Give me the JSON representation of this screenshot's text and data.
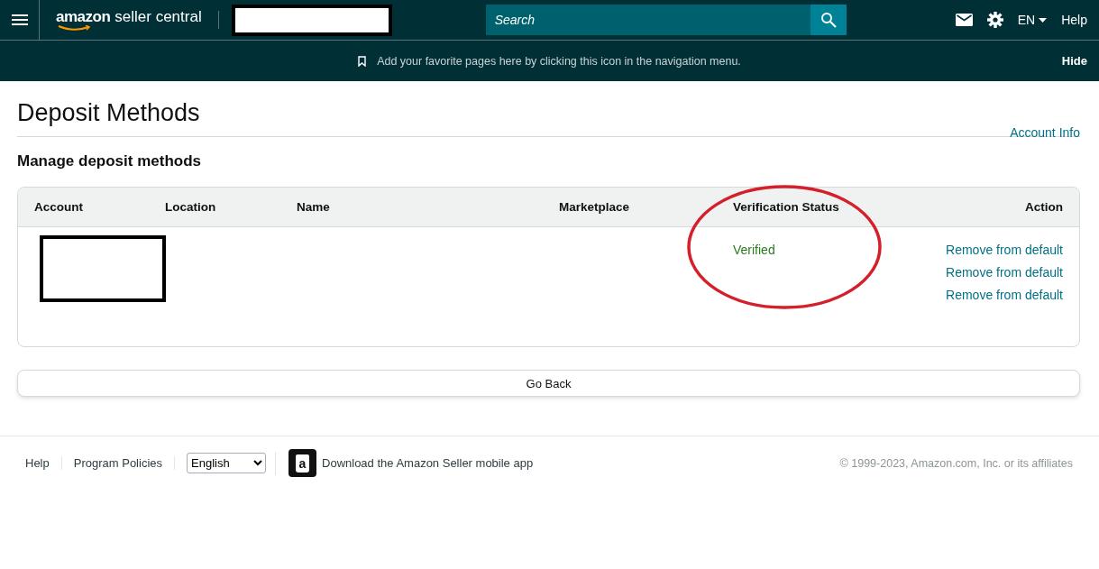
{
  "header": {
    "logo_word": "amazon",
    "logo_product": "seller central",
    "search": {
      "placeholder": "Search"
    },
    "language": "EN",
    "help": "Help"
  },
  "favorites_bar": {
    "message": "Add your favorite pages here by clicking this icon in the navigation menu.",
    "hide": "Hide"
  },
  "page": {
    "title": "Deposit Methods",
    "account_info_link": "Account Info",
    "section_title": "Manage deposit methods"
  },
  "table": {
    "columns": [
      "Account",
      "Location",
      "Name",
      "Marketplace",
      "Verification Status",
      "Action"
    ],
    "rows": [
      {
        "verification_status": "Verified",
        "actions": [
          "Remove from default",
          "Remove from default",
          "Remove from default"
        ]
      }
    ]
  },
  "go_back": "Go Back",
  "footer": {
    "links": [
      "Help",
      "Program Policies"
    ],
    "language_select": "English",
    "app_icon_letter": "a",
    "app_download": "Download the Amazon Seller mobile app",
    "copyright": "© 1999-2023, Amazon.com, Inc. or its affiliates"
  }
}
